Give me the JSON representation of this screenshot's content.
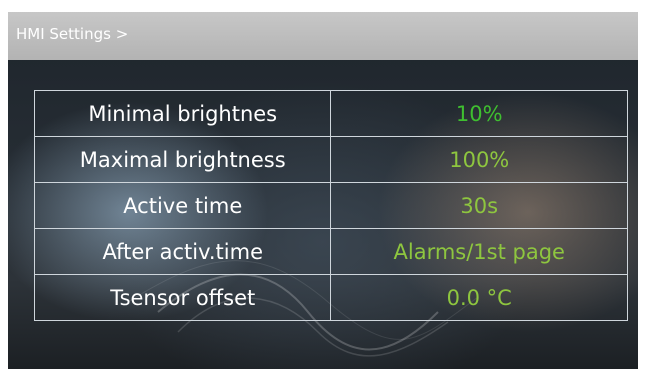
{
  "header": {
    "title": "HMI Settings >"
  },
  "colors": {
    "header_bar": "#bdbdbd",
    "label_text": "#ffffff",
    "value_green": "#3fbf30",
    "value_light_green": "#8ec63f",
    "grid_line": "#cfd6dc"
  },
  "settings": [
    {
      "label": "Minimal brightnes",
      "value": "10%"
    },
    {
      "label": "Maximal brightness",
      "value": "100%"
    },
    {
      "label": "Active time",
      "value": "30s"
    },
    {
      "label": "After activ.time",
      "value": "Alarms/1st page"
    },
    {
      "label": "Tsensor offset",
      "value": "0.0 °C"
    }
  ]
}
